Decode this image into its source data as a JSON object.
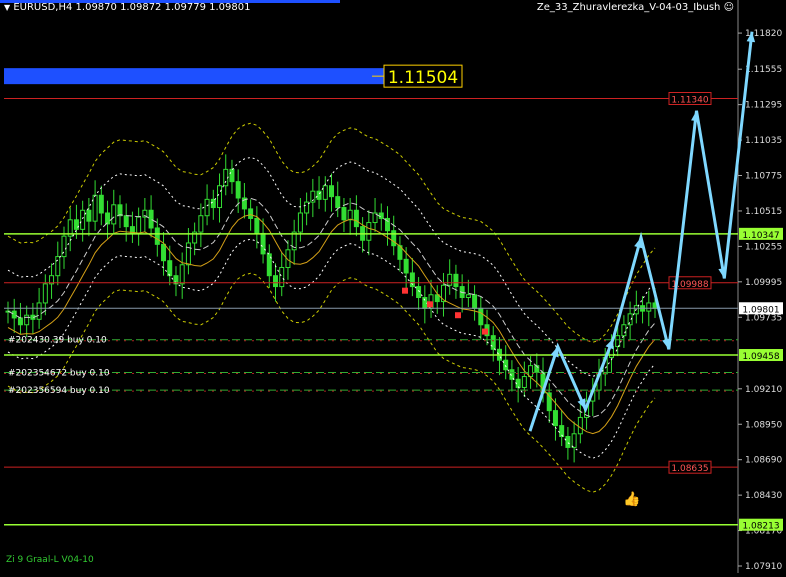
{
  "header": {
    "symbol_line": "EURUSD,H4  1.09870 1.09872 1.09779 1.09801",
    "indicator_name": "Ze_33_Zhuravlerezka_V-04-03_Ibush",
    "smiley_icon": "smiley-face-icon",
    "arrow_icon": "triangle-down-icon"
  },
  "footer": {
    "label": "Zi 9 Graal-L V04-10"
  },
  "price_box": {
    "value": "1.11504"
  },
  "colors": {
    "background": "#000000",
    "candle": "#33dd33",
    "lime_line": "#99ff33",
    "red_line": "#cc2222",
    "blue_band": "#1e50ff",
    "forecast": "#7fd8ff",
    "band_white": "#ffffff",
    "band_yellow": "#cccc00",
    "current_line": "#8899aa"
  },
  "order_labels": [
    {
      "text": "#202430.39 buy 0.10",
      "price": 1.0957
    },
    {
      "text": "#202354672 buy 0.10",
      "price": 1.0933
    },
    {
      "text": "#202356594 buy 0.10",
      "price": 1.092
    }
  ],
  "chart_data": {
    "type": "candlestick",
    "title": "EURUSD,H4",
    "ylim": [
      1.0791,
      1.1196
    ],
    "y_ticks": [
      "1.11820",
      "1.11555",
      "1.11295",
      "1.11035",
      "1.10775",
      "1.10515",
      "1.10255",
      "1.09995",
      "1.09735",
      "1.09210",
      "1.08950",
      "1.08690",
      "1.08430",
      "1.08170",
      "1.07910"
    ],
    "y_tick_values": [
      1.1182,
      1.11555,
      1.11295,
      1.11035,
      1.10775,
      1.10515,
      1.10255,
      1.09995,
      1.09735,
      1.0921,
      1.0895,
      1.0869,
      1.0843,
      1.0817,
      1.0791
    ],
    "current_price": {
      "label": "1.09801",
      "value": 1.09801
    },
    "lime_levels": [
      {
        "label": "1.10347",
        "value": 1.10347
      },
      {
        "label": "1.09458",
        "value": 1.09458
      },
      {
        "label": "1.08213",
        "value": 1.08213
      }
    ],
    "red_levels": [
      {
        "label": "1.11340",
        "value": 1.1134
      },
      {
        "label": "1.09988",
        "value": 1.09988
      },
      {
        "label": "1.08635",
        "value": 1.08635
      }
    ],
    "order_levels": [
      1.0957,
      1.0933,
      1.092
    ],
    "close_series": [
      1.0978,
      1.0973,
      1.0968,
      1.0975,
      1.0972,
      1.0984,
      1.0998,
      1.1004,
      1.1018,
      1.1033,
      1.1045,
      1.1038,
      1.1052,
      1.1044,
      1.1063,
      1.105,
      1.1042,
      1.1056,
      1.1048,
      1.104,
      1.1035,
      1.1047,
      1.1052,
      1.1039,
      1.1027,
      1.1015,
      1.1004,
      1.0998,
      1.1012,
      1.1028,
      1.1036,
      1.1048,
      1.106,
      1.1054,
      1.107,
      1.1082,
      1.1073,
      1.1061,
      1.1053,
      1.1046,
      1.1035,
      1.102,
      1.1004,
      1.0996,
      1.101,
      1.1023,
      1.1036,
      1.105,
      1.1058,
      1.1066,
      1.106,
      1.107,
      1.1062,
      1.1054,
      1.1045,
      1.1052,
      1.104,
      1.103,
      1.1043,
      1.105,
      1.1046,
      1.1037,
      1.1026,
      1.1016,
      1.1006,
      1.0996,
      1.0988,
      1.098,
      1.099,
      1.0985,
      1.0997,
      1.1005,
      1.0996,
      1.0988,
      1.099,
      1.098,
      1.0968,
      1.096,
      1.095,
      1.0942,
      1.0935,
      1.0928,
      1.0922,
      1.093,
      1.0938,
      1.0933,
      1.0918,
      1.0905,
      1.0894,
      1.0886,
      1.0878,
      1.0888,
      1.09,
      1.0912,
      1.092,
      1.0932,
      1.0944,
      1.0952,
      1.096,
      1.0968,
      1.0976,
      1.0982,
      1.0978,
      1.0984,
      1.098
    ],
    "forecast_points": [
      [
        1.089,
        0
      ],
      [
        1.0952,
        1
      ],
      [
        1.0906,
        2
      ],
      [
        1.0958,
        3
      ],
      [
        1.1032,
        4
      ],
      [
        1.095,
        5
      ],
      [
        1.1125,
        6
      ],
      [
        1.1002,
        7
      ],
      [
        1.1183,
        8
      ]
    ],
    "annotation_value": "1.11504"
  }
}
